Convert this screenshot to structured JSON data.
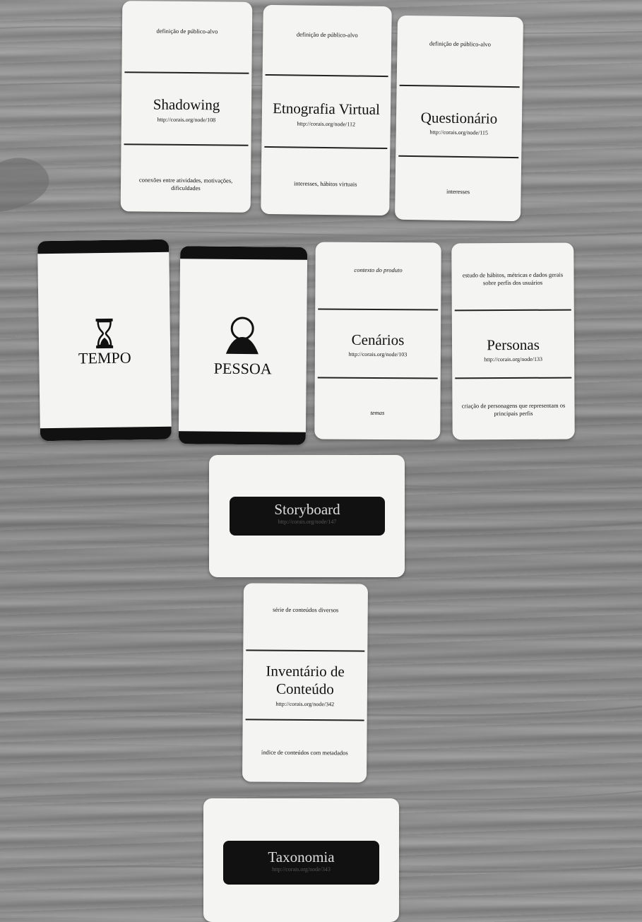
{
  "cards": {
    "shadowing": {
      "top": "definição de público-alvo",
      "title": "Shadowing",
      "url": "http://corais.org/node/108",
      "bottom": "conexões entre atividades, motivações, dificuldades"
    },
    "etnografia": {
      "top": "definição de público-alvo",
      "title": "Etnografia Virtual",
      "url": "http://corais.org/node/112",
      "bottom": "interesses, hábitos virtuais"
    },
    "questionario": {
      "top": "definição de público-alvo",
      "title": "Questionário",
      "url": "http://corais.org/node/115",
      "bottom": "interesses"
    },
    "tempo": {
      "label": "TEMPO",
      "icon": "hourglass-icon"
    },
    "pessoa": {
      "label": "PESSOA",
      "icon": "person-icon"
    },
    "cenarios": {
      "top": "contexto do produto",
      "title": "Cenários",
      "url": "http://corais.org/node/103",
      "bottom": "temas"
    },
    "personas": {
      "top": "estudo de hábitos, métricas e dados gerais sobre perfis dos usuários",
      "title": "Personas",
      "url": "http://corais.org/node/133",
      "bottom": "criação de personagens que representam os principais perfis"
    },
    "storyboard": {
      "title": "Storyboard",
      "url": "http://corais.org/node/147"
    },
    "inventario": {
      "top": "série de conteúdos diversos",
      "title": "Inventário de Conteúdo",
      "url": "http://corais.org/node/342",
      "bottom": "índice de conteúdos com metadados"
    },
    "taxonomia": {
      "title": "Taxonomia",
      "url": "http://corais.org/node/343"
    }
  },
  "colors": {
    "card": "#f4f4f2",
    "ink": "#111111",
    "table": "#959595"
  }
}
